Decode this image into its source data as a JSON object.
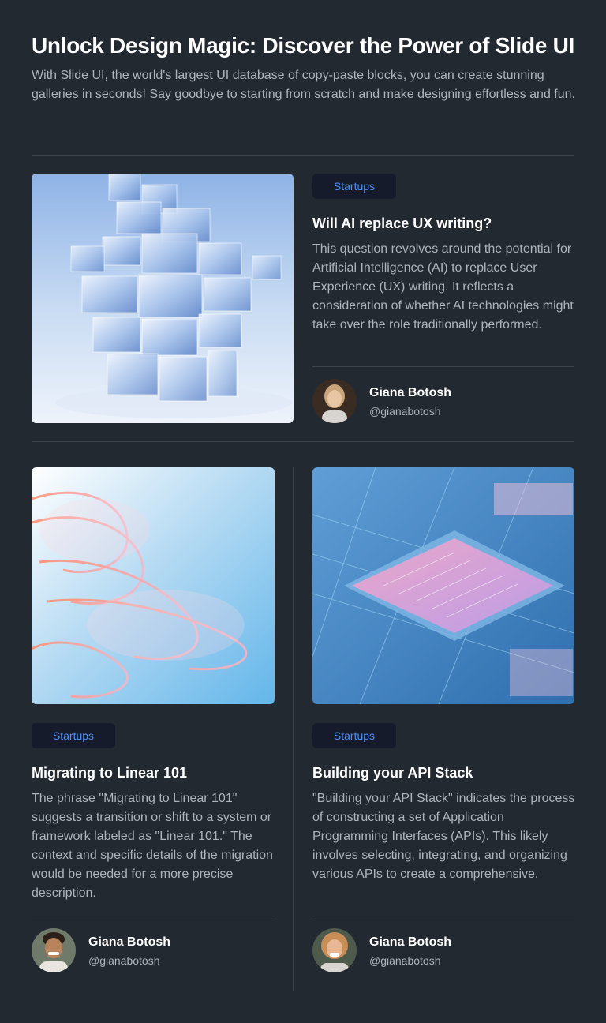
{
  "header": {
    "title": "Unlock Design Magic: Discover the Power of Slide UI",
    "subtitle": "With Slide UI, the world's largest UI database of copy-paste blocks, you can create stunning galleries in seconds! Say goodbye to starting from scratch and make designing effortless and fun."
  },
  "posts": [
    {
      "tag": "Startups",
      "title": "Will AI replace UX writing?",
      "body": "This question revolves around the potential for Artificial Intelligence (AI) to replace User Experience (UX) writing. It reflects a consideration of whether AI technologies might take over the role traditionally performed.",
      "author": {
        "name": "Giana Botosh",
        "handle": "@gianabotosh"
      },
      "image": "glass-cubes-tower-image"
    },
    {
      "tag": "Startups",
      "title": "Migrating to Linear 101",
      "body": "The phrase \"Migrating to Linear 101\" suggests a transition or shift to a system or framework labeled as \"Linear 101.\" The context and specific details of the migration would be needed for a more precise description.",
      "author": {
        "name": "Giana Botosh",
        "handle": "@gianabotosh"
      },
      "image": "glass-ribbons-image"
    },
    {
      "tag": "Startups",
      "title": "Building your API Stack",
      "body": "\"Building your API Stack\" indicates the process of constructing a set of Application Programming Interfaces (APIs). This likely involves selecting, integrating, and organizing various APIs to create a comprehensive.",
      "author": {
        "name": "Giana Botosh",
        "handle": "@gianabotosh"
      },
      "image": "circuit-chip-image"
    }
  ],
  "colors": {
    "background": "#232930",
    "badge_bg": "#151b2a",
    "badge_text": "#4f8ff7",
    "muted_text": "#aeb4bc",
    "divider": "#3c434b"
  }
}
